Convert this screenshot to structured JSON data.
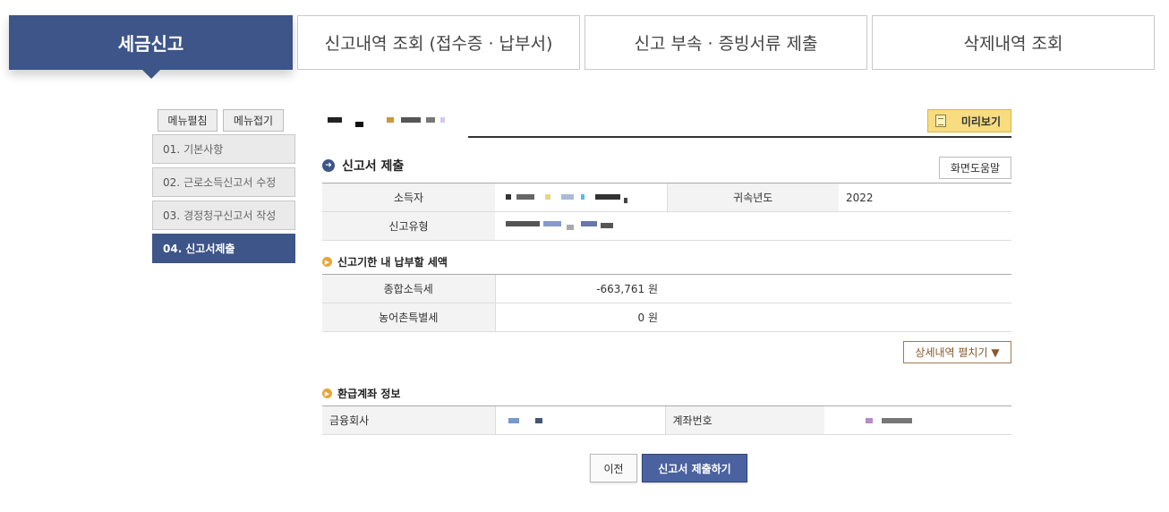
{
  "tabs": [
    {
      "label": "세금신고"
    },
    {
      "label": "신고내역 조회 (접수증 · 납부서)"
    },
    {
      "label": "신고 부속 · 증빙서류 제출"
    },
    {
      "label": "삭제내역 조회"
    }
  ],
  "menu": {
    "expand_label": "메뉴펼침",
    "collapse_label": "메뉴접기",
    "steps": [
      {
        "num": "01.",
        "label": "기본사항"
      },
      {
        "num": "02.",
        "label": "근로소득신고서 수정"
      },
      {
        "num": "03.",
        "label": "경정청구신고서 작성"
      },
      {
        "num": "04.",
        "label": "신고서제출"
      }
    ]
  },
  "header": {
    "preview_label": "미리보기"
  },
  "submission": {
    "title": "신고서 제출",
    "help_label": "화면도움말",
    "income_earner_label": "소득자",
    "year_label": "귀속년도",
    "year_value": "2022",
    "filing_type_label": "신고유형"
  },
  "tax": {
    "title": "신고기한 내 납부할 세액",
    "rows": [
      {
        "label": "종합소득세",
        "value": "-663,761 원"
      },
      {
        "label": "농어촌특별세",
        "value": "0 원"
      }
    ],
    "detail_label": "상세내역 펼치기 ▼"
  },
  "refund": {
    "title": "환급계좌 정보",
    "bank_label": "금융회사",
    "account_label": "계좌번호"
  },
  "actions": {
    "prev_label": "이전",
    "submit_label": "신고서 제출하기"
  },
  "colors": {
    "accent": "#3d5588",
    "preview_button": "#f7dd80",
    "orange_bullet": "#e9a437"
  }
}
